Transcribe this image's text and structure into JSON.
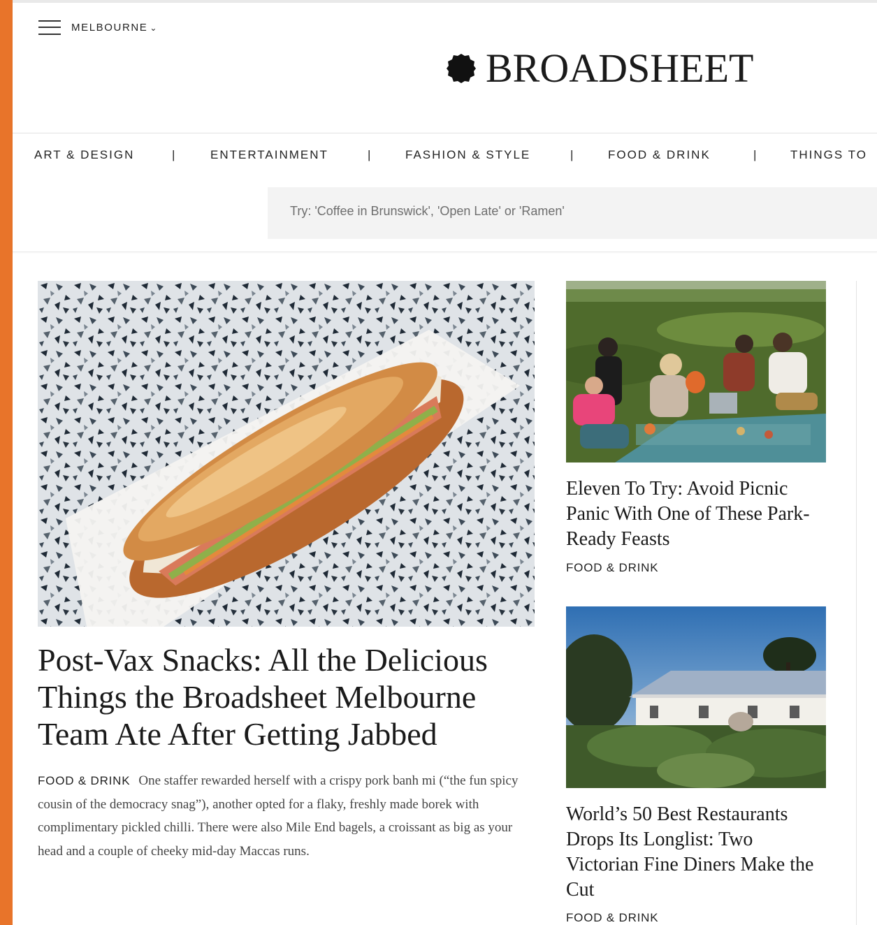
{
  "header": {
    "city": "MELBOURNE",
    "logo_text": "BROADSHEET"
  },
  "nav": {
    "items": [
      "ART & DESIGN",
      "ENTERTAINMENT",
      "FASHION & STYLE",
      "FOOD & DRINK",
      "THINGS TO"
    ],
    "separator": "|"
  },
  "search": {
    "placeholder": "Try: 'Coffee in Brunswick', 'Open Late' or 'Ramen'"
  },
  "feature": {
    "title": "Post-Vax Snacks: All the Delicious Things the Broadsheet Melbourne Team Ate After Getting Jabbed",
    "category": "FOOD & DRINK",
    "excerpt": "One staffer rewarded herself with a crispy pork banh mi (“the fun spicy cousin of the democracy snag”), another opted for a flaky, freshly made borek with complimentary pickled chilli. There were also Mile End bagels, a croissant as big as your head and a couple of cheeky mid-day Maccas runs."
  },
  "cards": [
    {
      "title": "Eleven To Try: Avoid Picnic Panic With One of These Park-Ready Feasts",
      "category": "FOOD & DRINK"
    },
    {
      "title": "World’s 50 Best Restaurants Drops Its Longlist: Two Victorian Fine Diners Make the Cut",
      "category": "FOOD & DRINK"
    }
  ],
  "colors": {
    "accent": "#e8742a",
    "text": "#1a1a1a",
    "search_bg": "#f3f3f3"
  },
  "icons": {
    "menu": "hamburger-icon",
    "chevron": "chevron-down-icon",
    "logo_mark": "logo-seal-icon"
  }
}
